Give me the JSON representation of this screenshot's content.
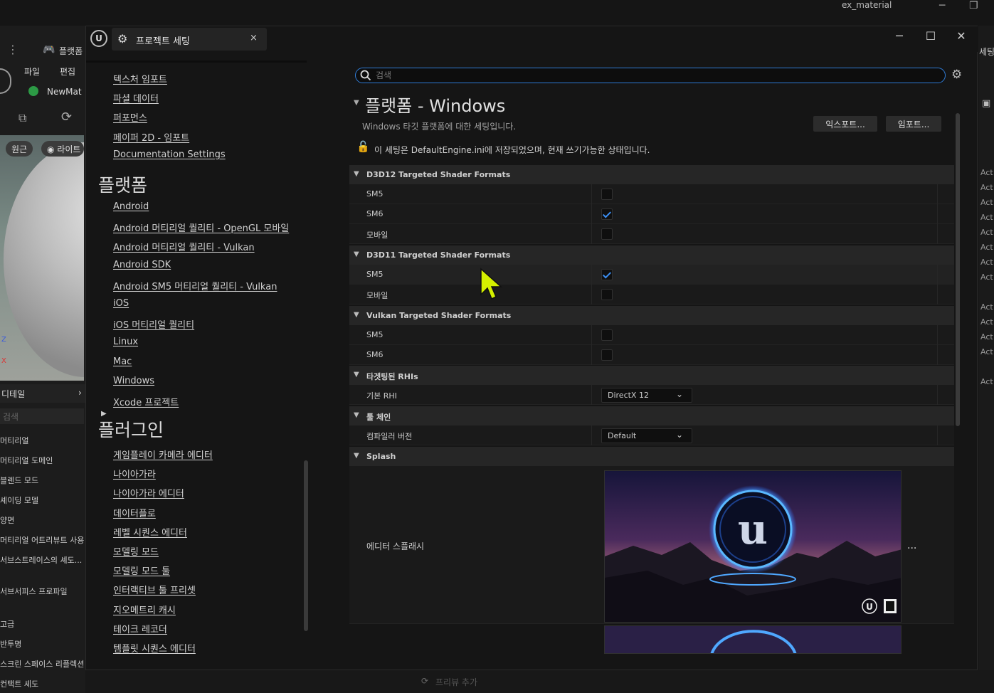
{
  "background_editor": {
    "window_title": "ex_material",
    "menu_file": "파일",
    "menu_edit": "편집",
    "asset_tab": "NewMat",
    "platform_tab": "플랫폼",
    "view_mode_pill": "원근",
    "light_pill": "라이트",
    "right_cut_label": "세팅",
    "details_header": "디테일",
    "details_search": "검색",
    "details_items": [
      "머티리얼",
      "머티리얼 도메인",
      "블렌드 모드",
      "셰이딩 모델",
      "양면",
      "머티리얼 어트리뷰트 사용",
      "서브스트레이스의 셰도...",
      "서브서피스 프로파일",
      "고급",
      "반투명",
      "스크린 스페이스 리플렉션",
      "컨택트 셰도"
    ],
    "right_column_items": [
      "Act",
      "Act",
      "Act",
      "Act",
      "Act",
      "Act",
      "Act",
      "Act",
      "Act",
      "Act",
      "Act",
      "Act",
      "Act"
    ],
    "bottom_bar_item": "프리뷰 추가"
  },
  "window": {
    "tab_title": "프로젝트 세팅",
    "tab_close": "×",
    "minimize": "─",
    "maximize": "☐",
    "close": "✕"
  },
  "sidebar": {
    "top_links": [
      "텍스처 임포트",
      "파셜 데이터",
      "퍼포먼스",
      "페이퍼 2D - 임포트",
      "Documentation Settings"
    ],
    "platform_category": "플랫폼",
    "platform_links": [
      "Android",
      "Android 머티리얼 퀄리티 - OpenGL 모바일",
      "Android 머티리얼 퀄리티 - Vulkan",
      "Android SDK",
      "Android SM5 머티리얼 퀄리티 - Vulkan",
      "iOS",
      "iOS 머티리얼 퀄리티",
      "Linux",
      "Mac",
      "Windows",
      "Xcode 프로젝트"
    ],
    "plugin_category": "플러그인",
    "plugin_links": [
      "게임플레이 카메라 에디터",
      "나이아가라",
      "나이아가라 에디터",
      "데이터플로",
      "레벨 시퀀스 에디터",
      "모델링 모드",
      "모델링 모드 툴",
      "인터랙티브 툴 프리셋",
      "지오메트리 캐시",
      "테이크 레코더",
      "템플릿 시퀀스 에디터"
    ]
  },
  "search": {
    "placeholder": "검색"
  },
  "section": {
    "title": "플랫폼 - Windows",
    "description": "Windows 타깃 플랫폼에 대한 세팅입니다.",
    "export_button": "익스포트...",
    "import_button": "임포트...",
    "config_note": "이 세팅은 DefaultEngine.ini에 저장되었으며, 현재 쓰기가능한 상태입니다."
  },
  "settings": {
    "d3d12": {
      "header": "D3D12 Targeted Shader Formats",
      "rows": [
        {
          "label": "SM5",
          "checked": false
        },
        {
          "label": "SM6",
          "checked": true
        },
        {
          "label": "모바일",
          "checked": false
        }
      ]
    },
    "d3d11": {
      "header": "D3D11 Targeted Shader Formats",
      "rows": [
        {
          "label": "SM5",
          "checked": true
        },
        {
          "label": "모바일",
          "checked": false
        }
      ]
    },
    "vulkan": {
      "header": "Vulkan Targeted Shader Formats",
      "rows": [
        {
          "label": "SM5",
          "checked": false
        },
        {
          "label": "SM6",
          "checked": false
        }
      ]
    },
    "rhi": {
      "header": "타겟팅된 RHIs",
      "default_label": "기본 RHI",
      "default_value": "DirectX 12"
    },
    "toolchain": {
      "header": "툴 체인",
      "compiler_label": "컴파일러 버전",
      "compiler_value": "Default"
    },
    "splash": {
      "header": "Splash",
      "editor_splash_label": "에디터 스플래시",
      "more": "..."
    }
  },
  "colors": {
    "accent": "#2f7bd6",
    "check": "#3b8ef2",
    "cursor": "#d4f000"
  }
}
